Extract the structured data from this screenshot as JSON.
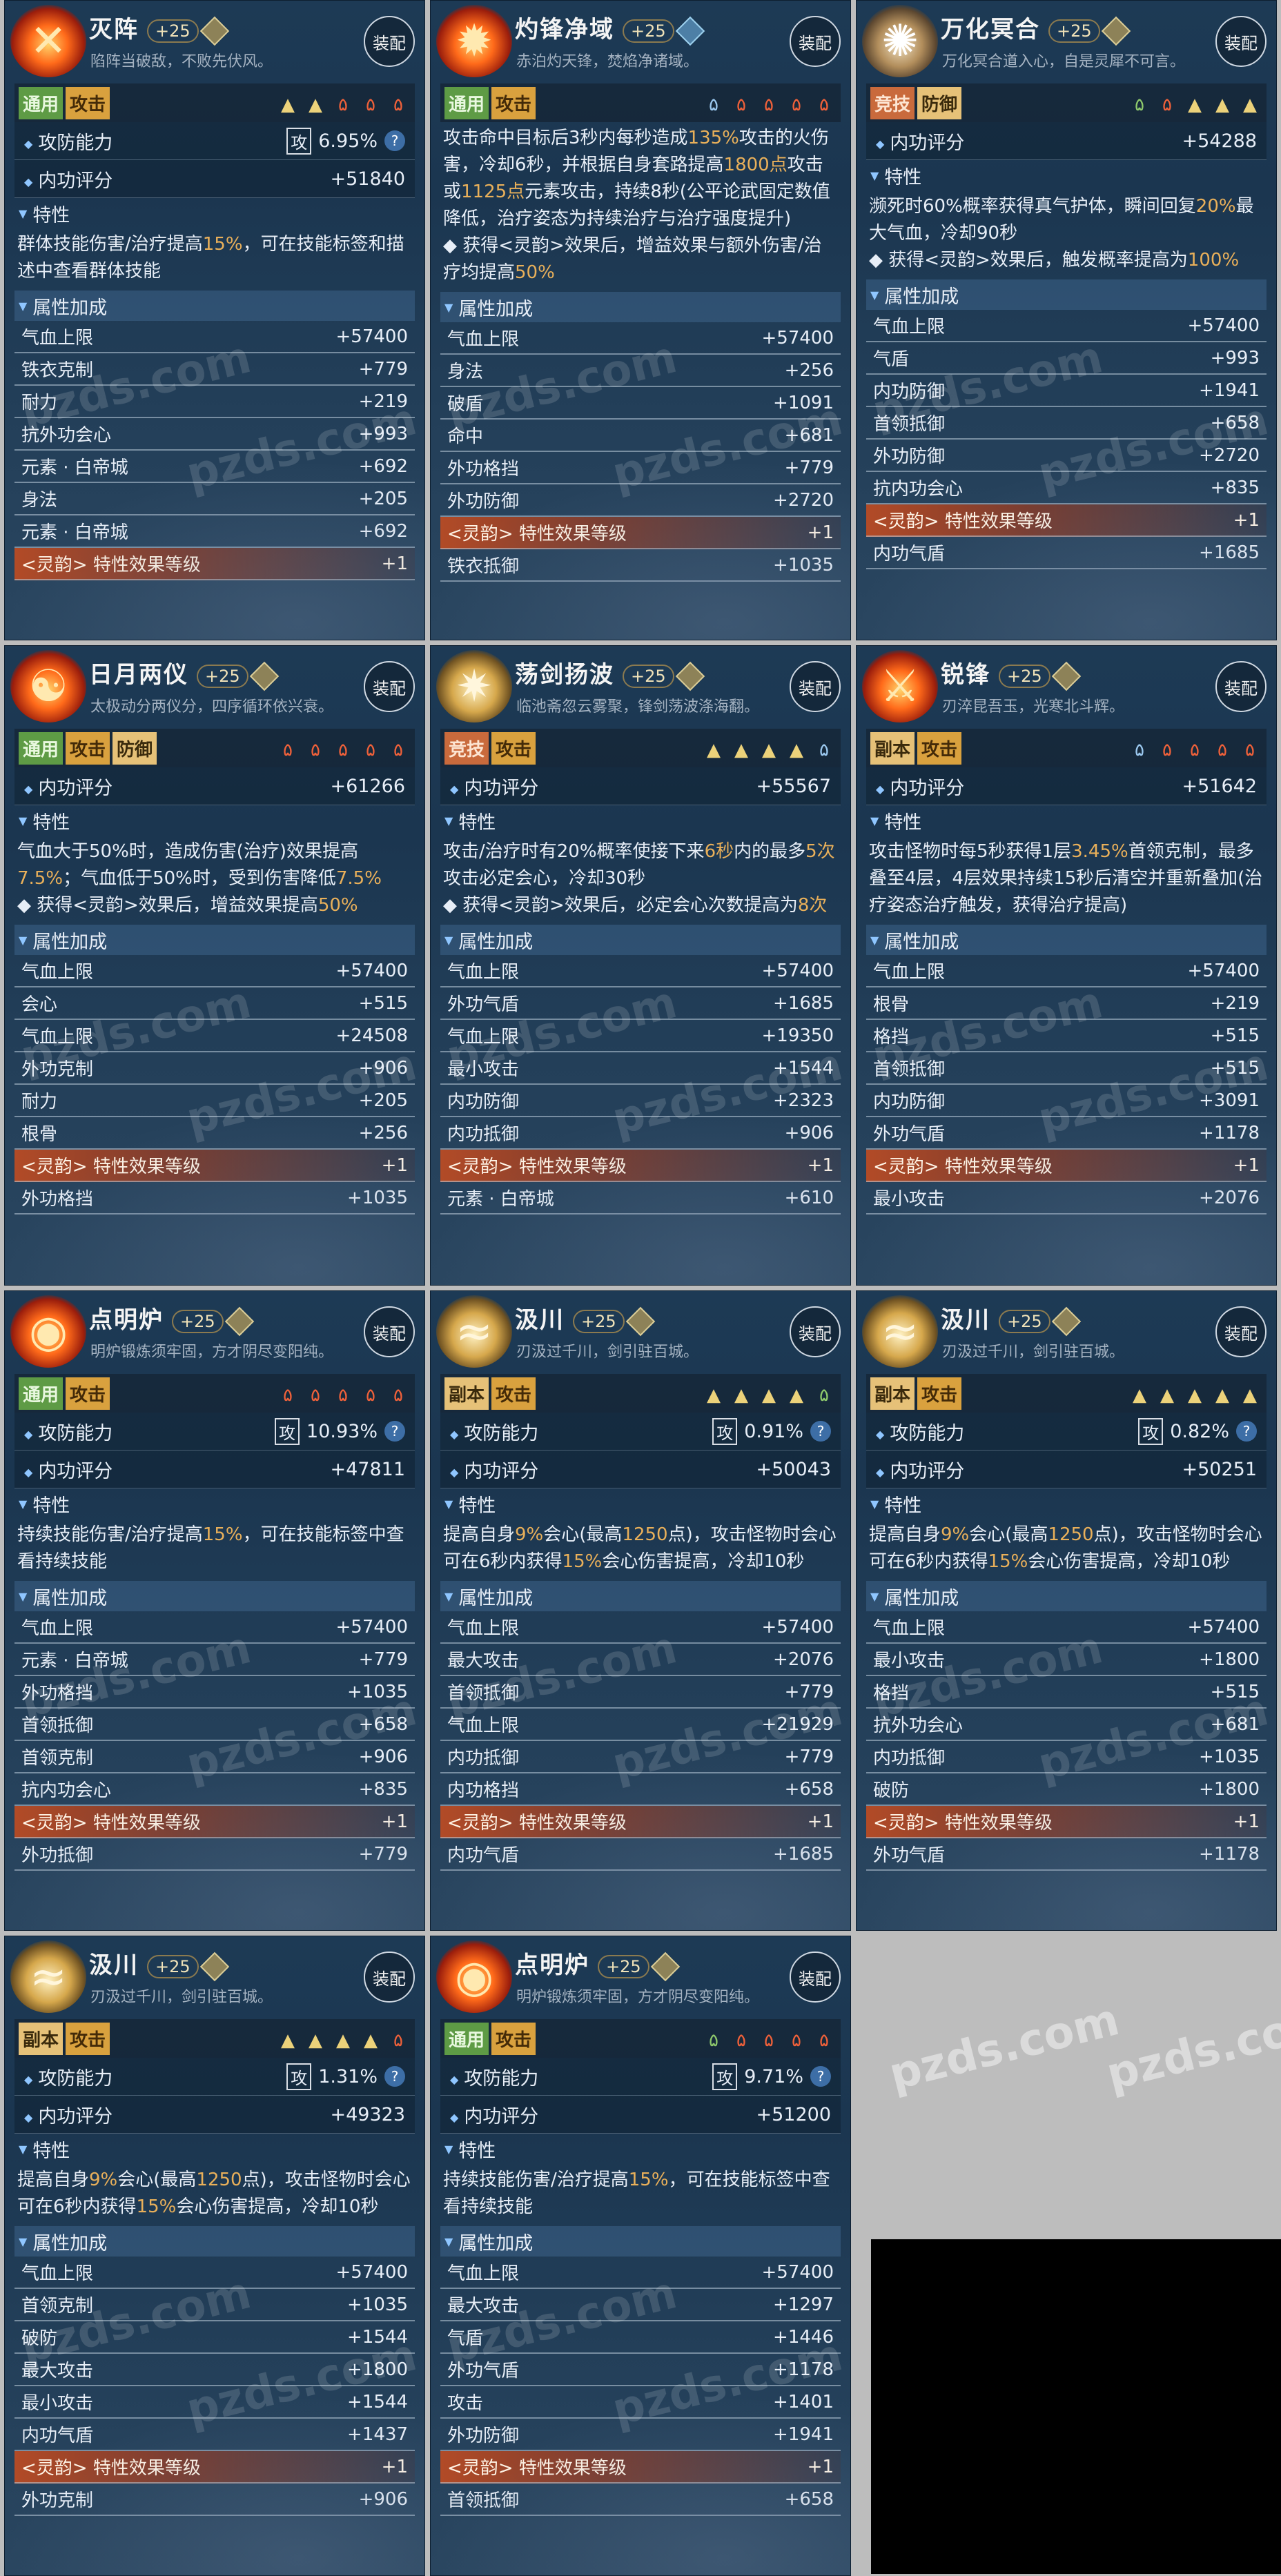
{
  "colors": {
    "panel_bg": "#1d3a55",
    "highlight": "#e9b05a",
    "background": "#bdbdbd"
  },
  "watermark": "pzds.com",
  "ui": {
    "equip_label": "装配",
    "attrs_header": "属性加成",
    "trait_header": "特性",
    "atk_box": "攻",
    "q": "?",
    "attack_label": "攻防能力",
    "score_label": "内功评分"
  },
  "panels": [
    {
      "name": "灭阵",
      "level": "+25",
      "subtitle": "陷阵当破敌，不败先伏风。",
      "icon": "fire",
      "icon_glyph": "✕",
      "gem": "gold",
      "tags": [
        [
          "通用",
          "g"
        ],
        [
          "攻击",
          "o"
        ]
      ],
      "runes": [
        [
          "▲",
          "yel"
        ],
        [
          "▲",
          "yel"
        ],
        [
          "۵",
          "red"
        ],
        [
          "۵",
          "red"
        ],
        [
          "۵",
          "red"
        ]
      ],
      "attack": "6.95%",
      "score": "+51840",
      "desc": [
        [
          "群体技能伤害/治疗提高",
          ""
        ],
        [
          "15%",
          "hl"
        ],
        [
          "，可在技能标签和描述中查看群体技能",
          ""
        ]
      ],
      "stats": [
        [
          "气血上限",
          "+57400"
        ],
        [
          "铁衣克制",
          "+779"
        ],
        [
          "耐力",
          "+219"
        ],
        [
          "抗外功会心",
          "+993"
        ],
        [
          "元素 · 白帝城",
          "+692"
        ],
        [
          "身法",
          "+205"
        ],
        [
          "元素 · 白帝城",
          "+692"
        ],
        [
          "<灵韵> 特性效果等级",
          "+1",
          "ly"
        ]
      ]
    },
    {
      "name": "灼锋净域",
      "level": "+25",
      "subtitle": "赤泊灼天锋，焚焰净诸域。",
      "icon": "fire",
      "icon_glyph": "✹",
      "gem": "blue",
      "tags": [
        [
          "通用",
          "g"
        ],
        [
          "攻击",
          "o"
        ]
      ],
      "runes": [
        [
          "۵",
          "blu"
        ],
        [
          "۵",
          "red"
        ],
        [
          "۵",
          "red"
        ],
        [
          "۵",
          "red"
        ],
        [
          "۵",
          "red"
        ]
      ],
      "attack": "",
      "score": "",
      "desc": [
        [
          "攻击命中目标后3秒内每秒造成",
          ""
        ],
        [
          "135%",
          "hl"
        ],
        [
          "攻击的火伤害，冷却6秒，并根据自身套路提高",
          ""
        ],
        [
          "1800点",
          "hl"
        ],
        [
          "攻击或",
          ""
        ],
        [
          "1125点",
          "hl"
        ],
        [
          "元素攻击，持续8秒(公平论武固定数值降低，治疗姿态为持续治疗与治疗强度提升)",
          ""
        ],
        [
          "\n◆ 获得<灵韵>效果后，增益效果与额外伤害/治疗均提高",
          ""
        ],
        [
          "50%",
          "hl"
        ]
      ],
      "stats": [
        [
          "气血上限",
          "+57400"
        ],
        [
          "身法",
          "+256"
        ],
        [
          "破盾",
          "+1091"
        ],
        [
          "命中",
          "+681"
        ],
        [
          "外功格挡",
          "+779"
        ],
        [
          "外功防御",
          "+2720"
        ],
        [
          "<灵韵> 特性效果等级",
          "+1",
          "ly"
        ],
        [
          "铁衣抵御",
          "+1035"
        ]
      ]
    },
    {
      "name": "万化冥合",
      "level": "+25",
      "subtitle": "万化冥合道入心，自是灵犀不可言。",
      "icon": "bronze",
      "icon_glyph": "✺",
      "gem": "gold",
      "tags": [
        [
          "竞技",
          "r"
        ],
        [
          "防御",
          "y"
        ]
      ],
      "runes": [
        [
          "۵",
          "grn"
        ],
        [
          "۵",
          "red"
        ],
        [
          "▲",
          "yel"
        ],
        [
          "▲",
          "yel"
        ],
        [
          "▲",
          "yel"
        ]
      ],
      "attack": "",
      "score": "+54288",
      "desc": [
        [
          "濒死时60%概率获得真气护体，瞬间回复",
          ""
        ],
        [
          "20%",
          "hl"
        ],
        [
          "最大气血，冷却90秒",
          ""
        ],
        [
          "\n◆ 获得<灵韵>效果后，触发概率提高为",
          ""
        ],
        [
          "100%",
          "hl"
        ]
      ],
      "stats": [
        [
          "气血上限",
          "+57400"
        ],
        [
          "气盾",
          "+993"
        ],
        [
          "内功防御",
          "+1941"
        ],
        [
          "首领抵御",
          "+658"
        ],
        [
          "外功防御",
          "+2720"
        ],
        [
          "抗内功会心",
          "+835"
        ],
        [
          "<灵韵> 特性效果等级",
          "+1",
          "ly"
        ],
        [
          "内功气盾",
          "+1685"
        ]
      ]
    },
    {
      "name": "日月两仪",
      "level": "+25",
      "subtitle": "太极动分两仪分，四序循环依兴衰。",
      "icon": "fire",
      "icon_glyph": "☯",
      "gem": "gold",
      "tags": [
        [
          "通用",
          "g"
        ],
        [
          "攻击",
          "o"
        ],
        [
          "防御",
          "y"
        ]
      ],
      "runes": [
        [
          "۵",
          "red"
        ],
        [
          "۵",
          "red"
        ],
        [
          "۵",
          "red"
        ],
        [
          "۵",
          "red"
        ],
        [
          "۵",
          "red"
        ]
      ],
      "attack": "",
      "score": "+61266",
      "desc": [
        [
          "气血大于50%时，造成伤害(治疗)效果提高",
          ""
        ],
        [
          "7.5%",
          "hl"
        ],
        [
          "；气血低于50%时，受到伤害降低",
          ""
        ],
        [
          "7.5%",
          "hl"
        ],
        [
          "\n◆ 获得<灵韵>效果后，增益效果提高",
          ""
        ],
        [
          "50%",
          "hl"
        ]
      ],
      "stats": [
        [
          "气血上限",
          "+57400"
        ],
        [
          "会心",
          "+515"
        ],
        [
          "气血上限",
          "+24508"
        ],
        [
          "外功克制",
          "+906"
        ],
        [
          "耐力",
          "+205"
        ],
        [
          "根骨",
          "+256"
        ],
        [
          "<灵韵> 特性效果等级",
          "+1",
          "ly"
        ],
        [
          "外功格挡",
          "+1035"
        ]
      ]
    },
    {
      "name": "荡剑扬波",
      "level": "+25",
      "subtitle": "临池斋忽云雾聚，锋剑荡波涤海翻。",
      "icon": "gold",
      "icon_glyph": "✷",
      "gem": "gold",
      "tags": [
        [
          "竞技",
          "r"
        ],
        [
          "攻击",
          "o"
        ]
      ],
      "runes": [
        [
          "▲",
          "yel"
        ],
        [
          "▲",
          "yel"
        ],
        [
          "▲",
          "yel"
        ],
        [
          "▲",
          "yel"
        ],
        [
          "۵",
          "blu"
        ]
      ],
      "attack": "",
      "score": "+55567",
      "desc": [
        [
          "攻击/治疗时有20%概率使接下来",
          ""
        ],
        [
          "6秒",
          "hl"
        ],
        [
          "内的最多",
          ""
        ],
        [
          "5次",
          "hl"
        ],
        [
          "攻击必定会心，冷却30秒",
          ""
        ],
        [
          "\n◆ 获得<灵韵>效果后，必定会心次数提高为",
          ""
        ],
        [
          "8次",
          "hl"
        ]
      ],
      "stats": [
        [
          "气血上限",
          "+57400"
        ],
        [
          "外功气盾",
          "+1685"
        ],
        [
          "气血上限",
          "+19350"
        ],
        [
          "最小攻击",
          "+1544"
        ],
        [
          "内功防御",
          "+2323"
        ],
        [
          "内功抵御",
          "+906"
        ],
        [
          "<灵韵> 特性效果等级",
          "+1",
          "ly"
        ],
        [
          "元素 · 白帝城",
          "+610"
        ]
      ]
    },
    {
      "name": "锐锋",
      "level": "+25",
      "subtitle": "刃淬昆吾玉，光寒北斗辉。",
      "icon": "fire",
      "icon_glyph": "⚔",
      "gem": "gold",
      "tags": [
        [
          "副本",
          "y"
        ],
        [
          "攻击",
          "o"
        ]
      ],
      "runes": [
        [
          "۵",
          "blu"
        ],
        [
          "۵",
          "red"
        ],
        [
          "۵",
          "red"
        ],
        [
          "۵",
          "red"
        ],
        [
          "۵",
          "red"
        ]
      ],
      "attack": "",
      "score": "+51642",
      "desc": [
        [
          "攻击怪物时每5秒获得1层",
          ""
        ],
        [
          "3.45%",
          "hl"
        ],
        [
          "首领克制，最多叠至4层，4层效果持续15秒后清空并重新叠加(治疗姿态治疗触发，获得治疗提高)",
          ""
        ]
      ],
      "stats": [
        [
          "气血上限",
          "+57400"
        ],
        [
          "根骨",
          "+219"
        ],
        [
          "格挡",
          "+515"
        ],
        [
          "首领抵御",
          "+515"
        ],
        [
          "内功防御",
          "+3091"
        ],
        [
          "外功气盾",
          "+1178"
        ],
        [
          "<灵韵> 特性效果等级",
          "+1",
          "ly"
        ],
        [
          "最小攻击",
          "+2076"
        ]
      ]
    },
    {
      "name": "点明炉",
      "level": "+25",
      "subtitle": "明炉锻炼须牢固，方才阴尽变阳纯。",
      "icon": "fire",
      "icon_glyph": "◉",
      "gem": "gold",
      "tags": [
        [
          "通用",
          "g"
        ],
        [
          "攻击",
          "o"
        ]
      ],
      "runes": [
        [
          "۵",
          "red"
        ],
        [
          "۵",
          "red"
        ],
        [
          "۵",
          "red"
        ],
        [
          "۵",
          "red"
        ],
        [
          "۵",
          "red"
        ]
      ],
      "attack": "10.93%",
      "score": "+47811",
      "desc": [
        [
          "持续技能伤害/治疗提高",
          ""
        ],
        [
          "15%",
          "hl"
        ],
        [
          "，可在技能标签中查看持续技能",
          ""
        ]
      ],
      "stats": [
        [
          "气血上限",
          "+57400"
        ],
        [
          "元素 · 白帝城",
          "+779"
        ],
        [
          "外功格挡",
          "+1035"
        ],
        [
          "首领抵御",
          "+658"
        ],
        [
          "首领克制",
          "+906"
        ],
        [
          "抗内功会心",
          "+835"
        ],
        [
          "<灵韵> 特性效果等级",
          "+1",
          "ly"
        ],
        [
          "外功抵御",
          "+779"
        ]
      ]
    },
    {
      "name": "汲川",
      "level": "+25",
      "subtitle": "刃汲过千川，剑引驻百城。",
      "icon": "gold",
      "icon_glyph": "≈",
      "gem": "gold",
      "tags": [
        [
          "副本",
          "y"
        ],
        [
          "攻击",
          "o"
        ]
      ],
      "runes": [
        [
          "▲",
          "yel"
        ],
        [
          "▲",
          "yel"
        ],
        [
          "▲",
          "yel"
        ],
        [
          "▲",
          "yel"
        ],
        [
          "۵",
          "grn"
        ]
      ],
      "attack": "0.91%",
      "score": "+50043",
      "desc": [
        [
          "提高自身",
          ""
        ],
        [
          "9%",
          "hl"
        ],
        [
          "会心(最高",
          ""
        ],
        [
          "1250",
          "hl"
        ],
        [
          "点)，攻击怪物时会心可在6秒内获得",
          ""
        ],
        [
          "15%",
          "hl"
        ],
        [
          "会心伤害提高，冷却10秒",
          ""
        ]
      ],
      "stats": [
        [
          "气血上限",
          "+57400"
        ],
        [
          "最大攻击",
          "+2076"
        ],
        [
          "首领抵御",
          "+779"
        ],
        [
          "气血上限",
          "+21929"
        ],
        [
          "内功抵御",
          "+779"
        ],
        [
          "内功格挡",
          "+658"
        ],
        [
          "<灵韵> 特性效果等级",
          "+1",
          "ly"
        ],
        [
          "内功气盾",
          "+1685"
        ]
      ]
    },
    {
      "name": "汲川",
      "level": "+25",
      "subtitle": "刃汲过千川，剑引驻百城。",
      "icon": "gold",
      "icon_glyph": "≈",
      "gem": "gold",
      "tags": [
        [
          "副本",
          "y"
        ],
        [
          "攻击",
          "o"
        ]
      ],
      "runes": [
        [
          "▲",
          "yel"
        ],
        [
          "▲",
          "yel"
        ],
        [
          "▲",
          "yel"
        ],
        [
          "▲",
          "yel"
        ],
        [
          "▲",
          "yel"
        ]
      ],
      "attack": "0.82%",
      "score": "+50251",
      "desc": [
        [
          "提高自身",
          ""
        ],
        [
          "9%",
          "hl"
        ],
        [
          "会心(最高",
          ""
        ],
        [
          "1250",
          "hl"
        ],
        [
          "点)，攻击怪物时会心可在6秒内获得",
          ""
        ],
        [
          "15%",
          "hl"
        ],
        [
          "会心伤害提高，冷却10秒",
          ""
        ]
      ],
      "stats": [
        [
          "气血上限",
          "+57400"
        ],
        [
          "最小攻击",
          "+1800"
        ],
        [
          "格挡",
          "+515"
        ],
        [
          "抗外功会心",
          "+681"
        ],
        [
          "内功抵御",
          "+1035"
        ],
        [
          "破防",
          "+1800"
        ],
        [
          "<灵韵> 特性效果等级",
          "+1",
          "ly"
        ],
        [
          "外功气盾",
          "+1178"
        ]
      ]
    },
    {
      "name": "汲川",
      "level": "+25",
      "subtitle": "刃汲过千川，剑引驻百城。",
      "icon": "gold",
      "icon_glyph": "≈",
      "gem": "gold",
      "tags": [
        [
          "副本",
          "y"
        ],
        [
          "攻击",
          "o"
        ]
      ],
      "runes": [
        [
          "▲",
          "yel"
        ],
        [
          "▲",
          "yel"
        ],
        [
          "▲",
          "yel"
        ],
        [
          "▲",
          "yel"
        ],
        [
          "۵",
          "red"
        ]
      ],
      "attack": "1.31%",
      "score": "+49323",
      "desc": [
        [
          "提高自身",
          ""
        ],
        [
          "9%",
          "hl"
        ],
        [
          "会心(最高",
          ""
        ],
        [
          "1250",
          "hl"
        ],
        [
          "点)，攻击怪物时会心可在6秒内获得",
          ""
        ],
        [
          "15%",
          "hl"
        ],
        [
          "会心伤害提高，冷却10秒",
          ""
        ]
      ],
      "stats": [
        [
          "气血上限",
          "+57400"
        ],
        [
          "首领克制",
          "+1035"
        ],
        [
          "破防",
          "+1544"
        ],
        [
          "最大攻击",
          "+1800"
        ],
        [
          "最小攻击",
          "+1544"
        ],
        [
          "内功气盾",
          "+1437"
        ],
        [
          "<灵韵> 特性效果等级",
          "+1",
          "ly"
        ],
        [
          "外功克制",
          "+906"
        ]
      ]
    },
    {
      "name": "点明炉",
      "level": "+25",
      "subtitle": "明炉锻炼须牢固，方才阴尽变阳纯。",
      "icon": "fire",
      "icon_glyph": "◉",
      "gem": "gold",
      "tags": [
        [
          "通用",
          "g"
        ],
        [
          "攻击",
          "o"
        ]
      ],
      "runes": [
        [
          "۵",
          "grn"
        ],
        [
          "۵",
          "red"
        ],
        [
          "۵",
          "red"
        ],
        [
          "۵",
          "red"
        ],
        [
          "۵",
          "red"
        ]
      ],
      "attack": "9.71%",
      "score": "+51200",
      "desc": [
        [
          "持续技能伤害/治疗提高",
          ""
        ],
        [
          "15%",
          "hl"
        ],
        [
          "，可在技能标签中查看持续技能",
          ""
        ]
      ],
      "stats": [
        [
          "气血上限",
          "+57400"
        ],
        [
          "最大攻击",
          "+1297"
        ],
        [
          "气盾",
          "+1446"
        ],
        [
          "外功气盾",
          "+1178"
        ],
        [
          "攻击",
          "+1401"
        ],
        [
          "外功防御",
          "+1941"
        ],
        [
          "<灵韵> 特性效果等级",
          "+1",
          "ly"
        ],
        [
          "首领抵御",
          "+658"
        ]
      ]
    }
  ]
}
